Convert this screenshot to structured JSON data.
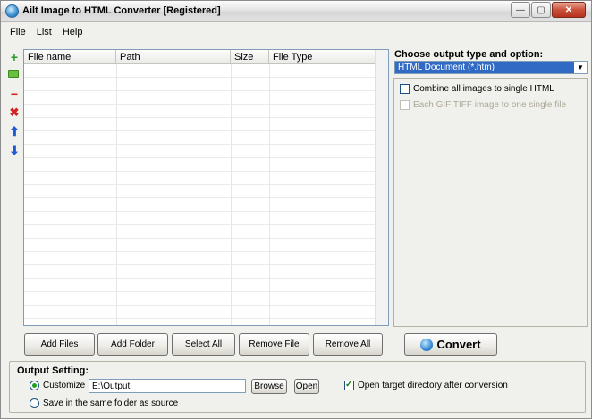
{
  "titlebar": {
    "title": "Ailt Image to HTML Converter [Registered]",
    "icons": {
      "app": "app-globe-icon",
      "minimize": "minimize-icon",
      "maximize": "maximize-icon",
      "close": "close-icon"
    },
    "minimize_glyph": "—",
    "maximize_glyph": "▢",
    "close_glyph": "✕"
  },
  "menu": {
    "items": [
      "File",
      "List",
      "Help"
    ]
  },
  "toolbar": {
    "icons": [
      "add-file-icon",
      "add-folder-icon",
      "remove-icon",
      "remove-all-icon",
      "move-up-icon",
      "move-down-icon"
    ],
    "glyphs": {
      "add": "+",
      "remove": "−",
      "remove_all": "✖",
      "up": "⬆",
      "down": "⬇"
    }
  },
  "filelist": {
    "columns": [
      "File name",
      "Path",
      "Size",
      "File Type"
    ],
    "rows": []
  },
  "options": {
    "label": "Choose output type and option:",
    "output_type": "HTML Document (*.htm)",
    "dropdown_glyph": "▼",
    "checkboxes": [
      {
        "label": "Combine all images to single HTML",
        "checked": false,
        "enabled": true
      },
      {
        "label": "Each GIF TIFF image to one single file",
        "checked": false,
        "enabled": false
      }
    ]
  },
  "buttons": {
    "add_files": "Add Files",
    "add_folder": "Add Folder",
    "select_all": "Select All",
    "remove_file": "Remove File",
    "remove_all": "Remove All",
    "convert": "Convert"
  },
  "output": {
    "label": "Output Setting:",
    "customize_label": "Customize",
    "path_value": "E:\\Output",
    "browse_label": "Browse",
    "open_label": "Open",
    "open_after_label": "Open target directory after conversion",
    "open_after_checked": true,
    "same_folder_label": "Save in the same folder as source",
    "selected": "customize"
  }
}
